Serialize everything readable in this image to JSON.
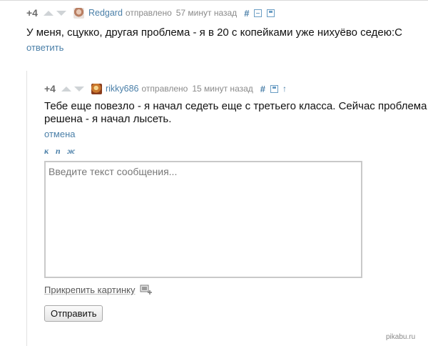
{
  "comment1": {
    "rating": "+4",
    "author": "Redgard",
    "sent": "отправлено",
    "time": "57 минут назад",
    "hash": "#",
    "text": "У меня, сцукко, другая проблема - я в 20 с копейками уже нихуёво седею:С",
    "reply_link": "ответить"
  },
  "comment2": {
    "rating": "+4",
    "author": "rikky686",
    "sent": "отправлено",
    "time": "15 минут назад",
    "hash": "#",
    "text_line1": "Тебе еще повезло - я начал седеть еще с третьего класса. Сейчас проблема",
    "text_line2": "решена - я начал лысеть.",
    "cancel_link": "отмена"
  },
  "format_buttons": [
    "к",
    "п",
    "ж"
  ],
  "reply_form": {
    "placeholder": "Введите текст сообщения...",
    "attach_label": "Прикрепить картинку",
    "submit_label": "Отправить"
  },
  "watermark": "pikabu.ru",
  "icons": {
    "vote_up": "triangle-up-icon",
    "vote_down": "triangle-down-icon",
    "collapse": "minus-box-icon",
    "save": "floppy-disk-icon",
    "parent": "arrow-up-icon",
    "attach": "image-add-icon"
  },
  "colors": {
    "link": "#4a7fa8",
    "meta": "#8a8a8a",
    "rating": "#6b6b6b"
  }
}
